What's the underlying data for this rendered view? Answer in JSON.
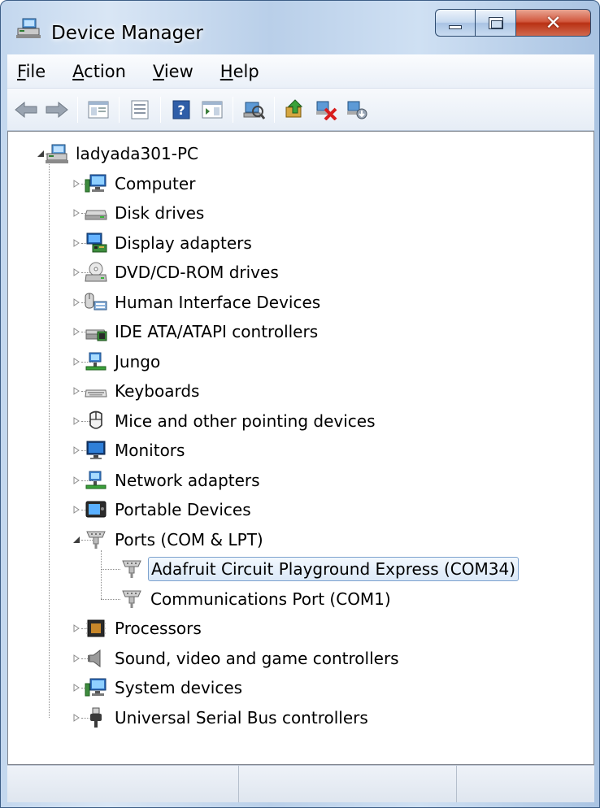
{
  "window": {
    "title": "Device Manager",
    "icon": "device-manager-icon",
    "controls": {
      "minimize": "minimize-icon",
      "maximize": "maximize-icon",
      "close": "close-icon"
    }
  },
  "menubar": {
    "items": [
      {
        "accel": "F",
        "rest": "ile"
      },
      {
        "accel": "A",
        "rest": "ction"
      },
      {
        "accel": "V",
        "rest": "iew"
      },
      {
        "accel": "H",
        "rest": "elp"
      }
    ]
  },
  "toolbar": {
    "buttons": [
      "back-icon",
      "forward-icon",
      "show-hide-console-tree-icon",
      "properties-icon",
      "help-icon",
      "show-action-pane-icon",
      "scan-hardware-changes-icon",
      "update-driver-icon",
      "uninstall-device-icon",
      "disable-device-icon"
    ]
  },
  "tree": {
    "root": {
      "label": "ladyada301-PC",
      "icon": "computer-network-icon",
      "expanded": true
    },
    "categories": [
      {
        "label": "Computer",
        "icon": "computer-icon"
      },
      {
        "label": "Disk drives",
        "icon": "disk-drive-icon"
      },
      {
        "label": "Display adapters",
        "icon": "display-adapter-icon"
      },
      {
        "label": "DVD/CD-ROM drives",
        "icon": "dvd-drive-icon"
      },
      {
        "label": "Human Interface Devices",
        "icon": "hid-icon"
      },
      {
        "label": "IDE ATA/ATAPI controllers",
        "icon": "ide-controller-icon"
      },
      {
        "label": "Jungo",
        "icon": "jungo-icon"
      },
      {
        "label": "Keyboards",
        "icon": "keyboard-icon"
      },
      {
        "label": "Mice and other pointing devices",
        "icon": "mouse-icon"
      },
      {
        "label": "Monitors",
        "icon": "monitor-icon"
      },
      {
        "label": "Network adapters",
        "icon": "network-adapter-icon"
      },
      {
        "label": "Portable Devices",
        "icon": "portable-device-icon"
      },
      {
        "label": "Ports (COM & LPT)",
        "icon": "port-icon",
        "expanded": true,
        "children": [
          {
            "label": "Adafruit Circuit Playground Express (COM34)",
            "icon": "port-icon",
            "selected": true
          },
          {
            "label": "Communications Port (COM1)",
            "icon": "port-icon"
          }
        ]
      },
      {
        "label": "Processors",
        "icon": "processor-icon"
      },
      {
        "label": "Sound, video and game controllers",
        "icon": "speaker-icon"
      },
      {
        "label": "System devices",
        "icon": "system-device-icon"
      },
      {
        "label": "Universal Serial Bus controllers",
        "icon": "usb-icon"
      }
    ]
  },
  "statusbar": {
    "cells": [
      "",
      "",
      ""
    ]
  }
}
